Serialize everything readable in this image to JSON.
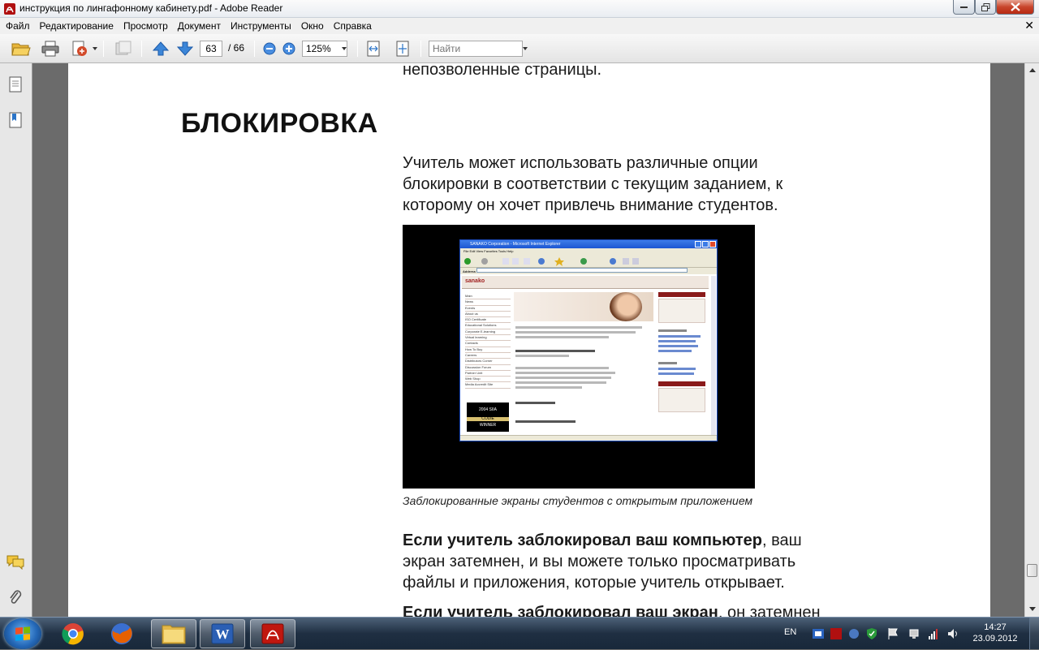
{
  "window": {
    "title": "инструкция по лингафонному кабинету.pdf - Adobe Reader"
  },
  "menu": {
    "items": [
      "Файл",
      "Редактирование",
      "Просмотр",
      "Документ",
      "Инструменты",
      "Окно",
      "Справка"
    ]
  },
  "toolbar": {
    "page_current": "63",
    "page_total": "/ 66",
    "zoom": "125%",
    "find_placeholder": "Найти",
    "icons": [
      "open-icon",
      "print-icon",
      "create-pdf-icon",
      "collaborate-icon",
      "previous-page-icon",
      "next-page-icon",
      "zoom-out-icon",
      "zoom-in-icon",
      "fit-width-icon",
      "fit-page-icon"
    ]
  },
  "document": {
    "top_fragment": "непозволенные страницы.",
    "heading": "БЛОКИРОВКА",
    "paragraph1": [
      "Учитель может использовать различные опции",
      "блокировки в соответствии с текущим заданием, к",
      "которому он хочет привлечь внимание студентов."
    ],
    "caption": "Заблокированные экраны студентов с открытым приложением",
    "paragraph2": {
      "bold": "Если учитель заблокировал ваш компьютер",
      "rest_line1": ", ваш",
      "line2": "экран затемнен, и вы можете только просматривать",
      "line3": "файлы и приложения, которые учитель открывает."
    },
    "paragraph3": {
      "bold": "Если учитель заблокировал ваш экран",
      "rest": ", он затемнен"
    },
    "figure": {
      "browser_title": "SANAKO Corporation - Microsoft Internet Explorer",
      "browser_menu": "File  Edit  View  Favorites  Tools  Help",
      "address_label": "Address",
      "site_logo": "sanako",
      "nav_items": [
        "Main",
        "News",
        "Events",
        "About us",
        "ISO Certificate",
        "Educational Solutions",
        "Corporate E-learning",
        "Virtual learning",
        "Contacts",
        "How To Buy",
        "Careers",
        "Distributors Corner",
        "Discussion Forum",
        "Partner Unit",
        "Web Shop",
        "Media Accredit Site"
      ],
      "award_year": "2004 SIIA",
      "award_text": "CODiE",
      "award_label": "WINNER"
    }
  },
  "taskbar": {
    "language": "EN",
    "time": "14:27",
    "date": "23.09.2012",
    "apps": [
      "chrome-icon",
      "firefox-icon",
      "explorer-icon",
      "word-icon",
      "acrobat-icon"
    ]
  },
  "colors": {
    "accent_red": "#c8452c",
    "taskbar": "#1f2f42",
    "toolbar_blue": "#2a74c8"
  }
}
